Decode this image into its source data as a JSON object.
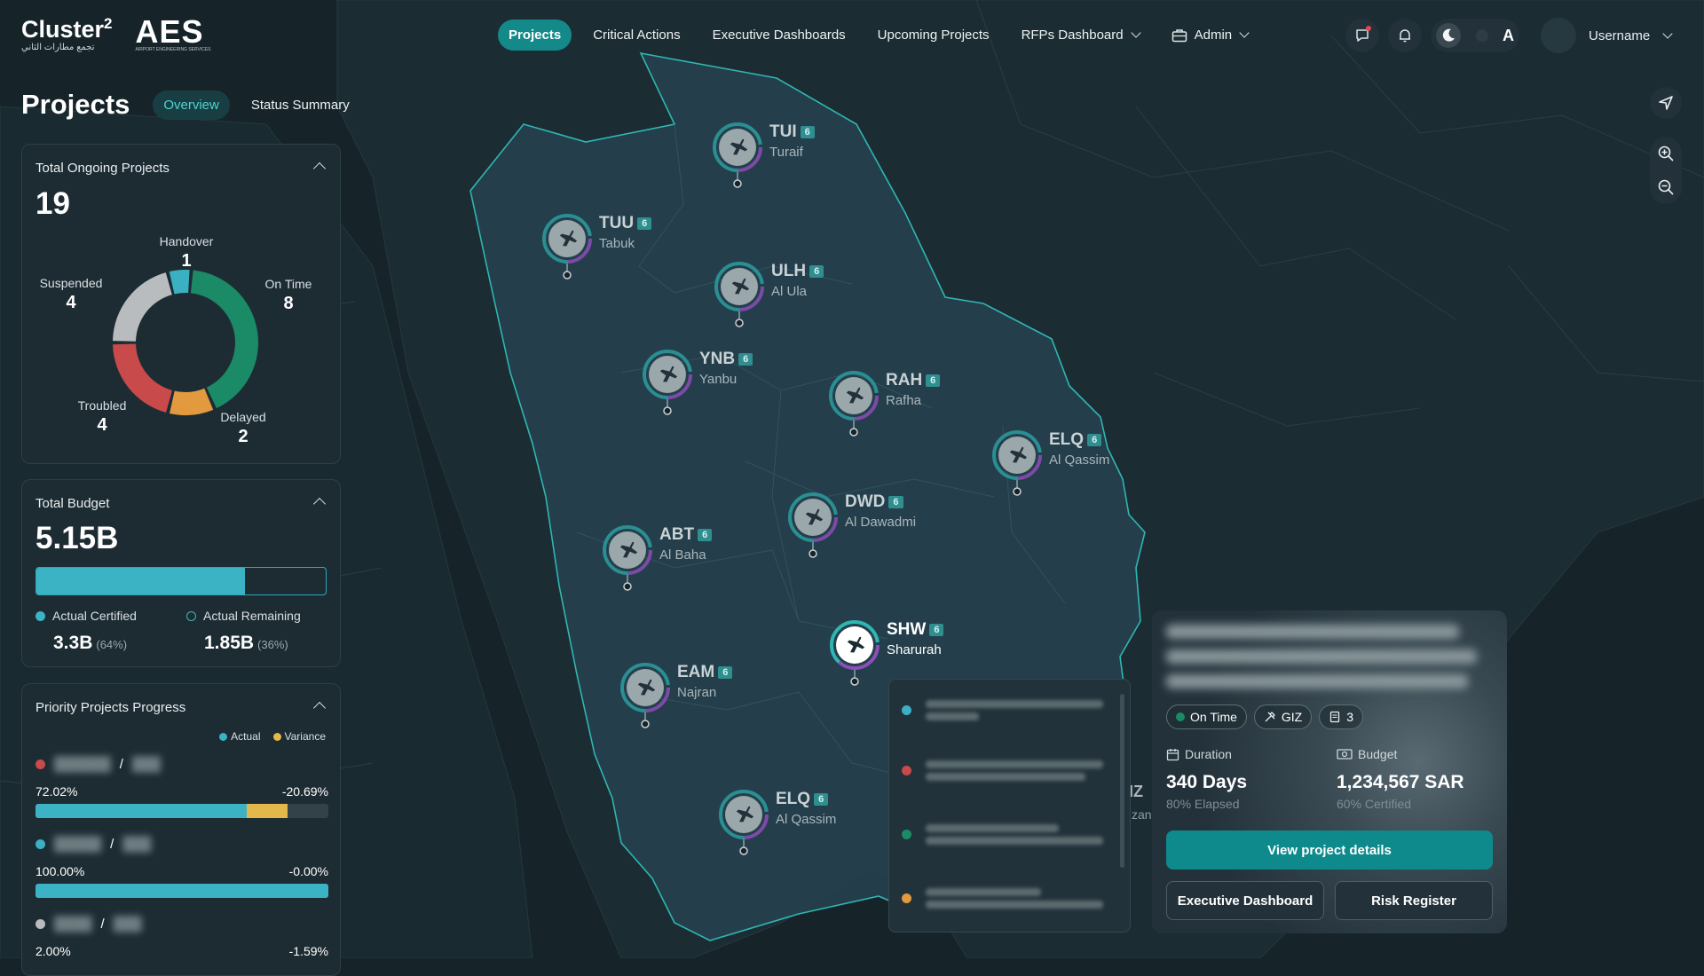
{
  "header": {
    "logo_primary": "Cluster",
    "logo_sup": "2",
    "logo_primary_sub": "تجمع مطارات الثاني",
    "logo_secondary": "AES",
    "logo_secondary_sub": "AIRPORT ENGINEERING SERVICES",
    "nav": [
      {
        "label": "Projects",
        "active": true
      },
      {
        "label": "Critical Actions"
      },
      {
        "label": "Executive Dashboards"
      },
      {
        "label": "Upcoming Projects"
      },
      {
        "label": "RFPs Dashboard",
        "dropdown": true
      },
      {
        "label": "Admin",
        "dropdown": true,
        "icon": "briefcase-icon"
      }
    ],
    "theme_letter": "A",
    "username": "Username"
  },
  "page": {
    "title": "Projects",
    "tabs": [
      {
        "label": "Overview",
        "active": true
      },
      {
        "label": "Status Summary"
      }
    ]
  },
  "ongoing": {
    "title": "Total Ongoing Projects",
    "total": "19",
    "segments": [
      {
        "label": "Handover",
        "value": 1,
        "color": "#3bb0c2"
      },
      {
        "label": "On Time",
        "value": 8,
        "color": "#1b8a66"
      },
      {
        "label": "Delayed",
        "value": 2,
        "color": "#e39a3e"
      },
      {
        "label": "Troubled",
        "value": 4,
        "color": "#c84a4a"
      },
      {
        "label": "Suspended",
        "value": 4,
        "color": "#b9bcbe"
      }
    ]
  },
  "budget": {
    "title": "Total Budget",
    "total": "5.15B",
    "certified_fraction": 0.72,
    "certified_label": "Actual Certified",
    "certified_value": "3.3B",
    "certified_pct": "(64%)",
    "remaining_label": "Actual Remaining",
    "remaining_value": "1.85B",
    "remaining_pct": "(36%)"
  },
  "priority": {
    "title": "Priority Projects Progress",
    "legend_actual": "Actual",
    "legend_variance": "Variance",
    "rows": [
      {
        "status_color": "#c84a4a",
        "actual": "72.02%",
        "variance": "-20.69%",
        "actual_fraction": 0.72,
        "variance_fraction": 0.14
      },
      {
        "status_color": "#3bb0c2",
        "actual": "100.00%",
        "variance": "-0.00%",
        "actual_fraction": 1.0,
        "variance_fraction": 0
      },
      {
        "status_color": "#b9bcbe",
        "actual": "2.00%",
        "variance": "-1.59%",
        "actual_fraction": 0.02,
        "variance_fraction": 0.02
      }
    ]
  },
  "airports": [
    {
      "code": "TUI",
      "city": "Turaif",
      "count": "6"
    },
    {
      "code": "TUU",
      "city": "Tabuk",
      "count": "6"
    },
    {
      "code": "ULH",
      "city": "Al Ula",
      "count": "6"
    },
    {
      "code": "YNB",
      "city": "Yanbu",
      "count": "6"
    },
    {
      "code": "RAH",
      "city": "Rafha",
      "count": "6"
    },
    {
      "code": "ELQ",
      "city": "Al Qassim",
      "count": "6"
    },
    {
      "code": "DWD",
      "city": "Al Dawadmi",
      "count": "6"
    },
    {
      "code": "ABT",
      "city": "Al Baha",
      "count": "6"
    },
    {
      "code": "SHW",
      "city": "Sharurah",
      "count": "6",
      "selected": true
    },
    {
      "code": "EAM",
      "city": "Najran",
      "count": "6"
    },
    {
      "code": "ELQ",
      "city": "Al Qassim",
      "count": "6"
    }
  ],
  "list_popup": {
    "dot_colors": [
      "#3bb0c2",
      "#c84a4a",
      "#1b8a66",
      "#e39a3e"
    ]
  },
  "partial_marker": {
    "code": "IZ",
    "city": "zan"
  },
  "project_card": {
    "status": "On Time",
    "status_color": "#1b8a66",
    "tag": "GIZ",
    "doc_count": "3",
    "duration_label": "Duration",
    "duration_value": "340 Days",
    "duration_sub": "80% Elapsed",
    "budget_label": "Budget",
    "budget_value": "1,234,567 SAR",
    "budget_sub": "60% Certified",
    "primary_button": "View project details",
    "button_exec": "Executive Dashboard",
    "button_risk": "Risk Register"
  }
}
